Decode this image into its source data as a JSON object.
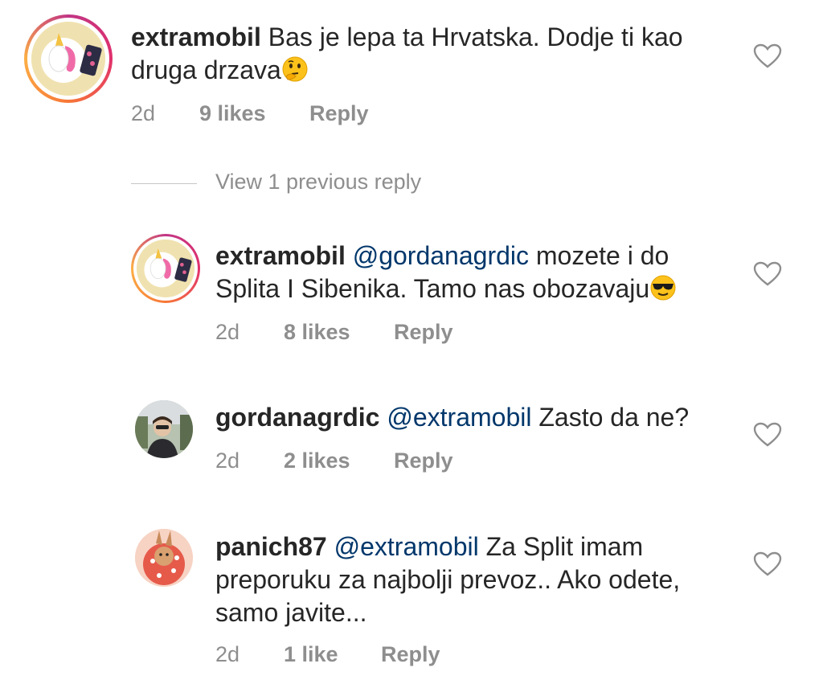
{
  "comments": [
    {
      "user": "extramobil",
      "text": "Bas je lepa ta Hrvatska. Dodje ti kao druga drzava",
      "text_line1": "Bas je lepa ta Hrvatska. Dodje ti kao",
      "text_line2": "druga drzava",
      "emoji": "thinking-face",
      "time": "2d",
      "likes": "9 likes",
      "reply": "Reply"
    }
  ],
  "view_replies": "View 1 previous reply",
  "replies": [
    {
      "user": "extramobil",
      "mention": "@gordanagrdic",
      "text_line1": "mozete i do",
      "text_line2": "Splita I Sibenika. Tamo nas obozavaju",
      "emoji": "sunglasses-face",
      "time": "2d",
      "likes": "8 likes",
      "reply": "Reply"
    },
    {
      "user": "gordanagrdic",
      "mention": "@extramobil",
      "text_line1": "Zasto da ne?",
      "time": "2d",
      "likes": "2 likes",
      "reply": "Reply"
    },
    {
      "user": "panich87",
      "mention": "@extramobil",
      "text_line1": "Za Split imam",
      "text_line2": "preporuku za najbolji prevoz.. Ako odete,",
      "text_line3": "samo javite...",
      "time": "2d",
      "likes": "1 like",
      "reply": "Reply"
    }
  ]
}
